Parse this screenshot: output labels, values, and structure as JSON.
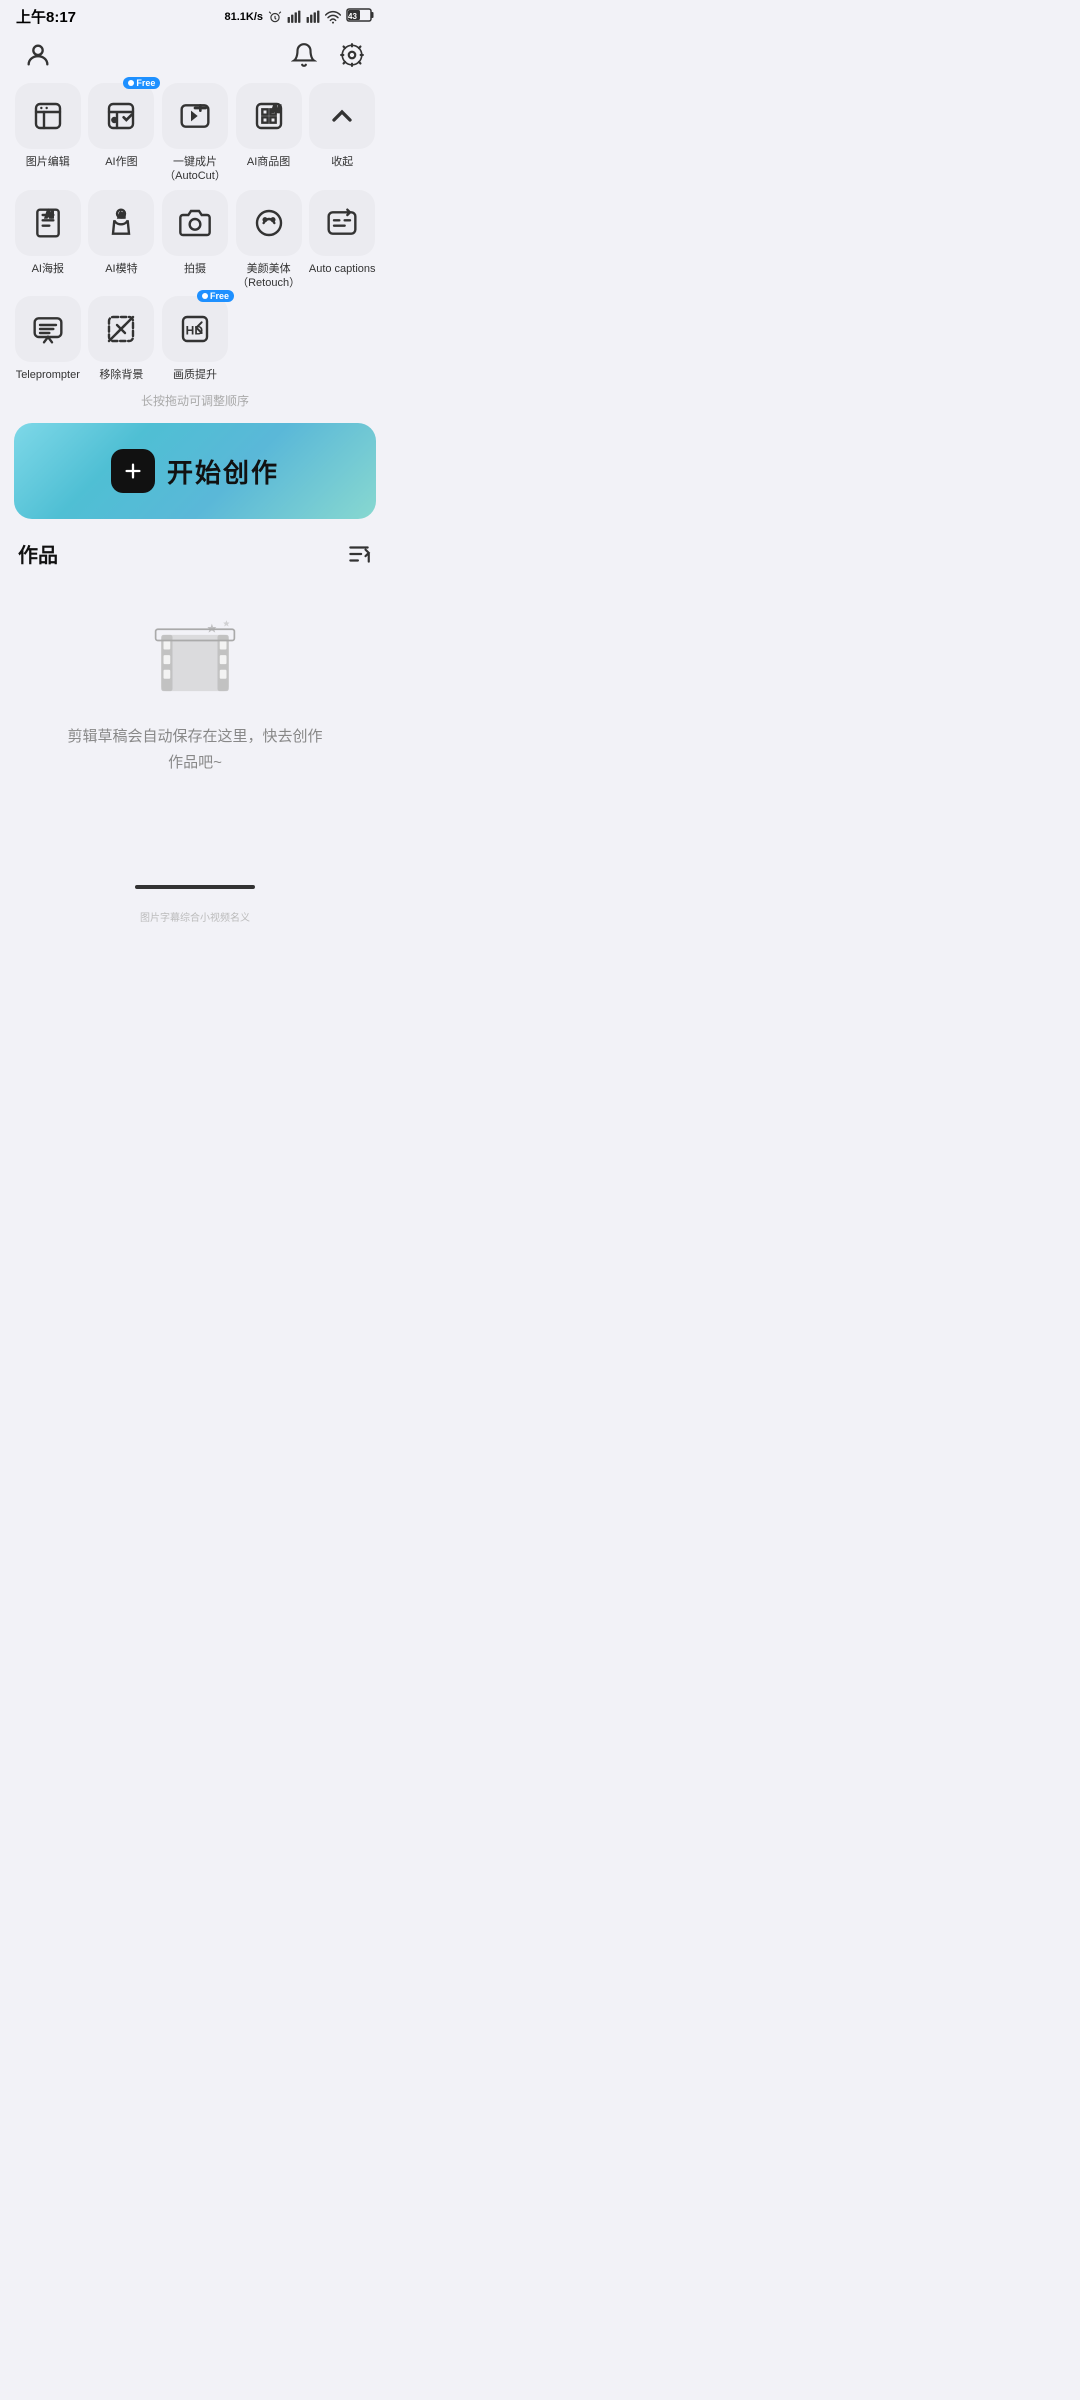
{
  "statusBar": {
    "time": "上午8:17",
    "network": "81.1K/s",
    "battery": "43"
  },
  "header": {
    "profileIcon": "person-icon",
    "bellIcon": "bell-icon",
    "settingsIcon": "settings-icon"
  },
  "tools": {
    "row1": [
      {
        "id": "photo-edit",
        "label": "图片编辑",
        "hasFree": false
      },
      {
        "id": "ai-draw",
        "label": "AI作图",
        "hasFree": true
      },
      {
        "id": "autocut",
        "label": "一键成片\n（AutoCut）",
        "hasFree": false
      },
      {
        "id": "ai-product",
        "label": "AI商品图",
        "hasFree": false
      },
      {
        "id": "collapse",
        "label": "收起",
        "hasFree": false
      }
    ],
    "row2": [
      {
        "id": "ai-poster",
        "label": "AI海报",
        "hasFree": false
      },
      {
        "id": "ai-model",
        "label": "AI模特",
        "hasFree": false
      },
      {
        "id": "camera",
        "label": "拍摄",
        "hasFree": false
      },
      {
        "id": "retouch",
        "label": "美颜美体\n（Retouch）",
        "hasFree": false
      },
      {
        "id": "auto-captions",
        "label": "Auto captions",
        "hasFree": false
      }
    ],
    "row3": [
      {
        "id": "teleprompter",
        "label": "Teleprompter",
        "hasFree": false
      },
      {
        "id": "remove-bg",
        "label": "移除背景",
        "hasFree": false
      },
      {
        "id": "hd-enhance",
        "label": "画质提升",
        "hasFree": true
      }
    ]
  },
  "dragHint": "长按拖动可调整顺序",
  "startButton": {
    "label": "开始创作"
  },
  "worksSection": {
    "title": "作品",
    "manageLabel": ""
  },
  "emptyState": {
    "text": "剪辑草稿会自动保存在这里，快去创作\n作品吧~"
  },
  "watermark": "图片字幕综合小视频名义"
}
